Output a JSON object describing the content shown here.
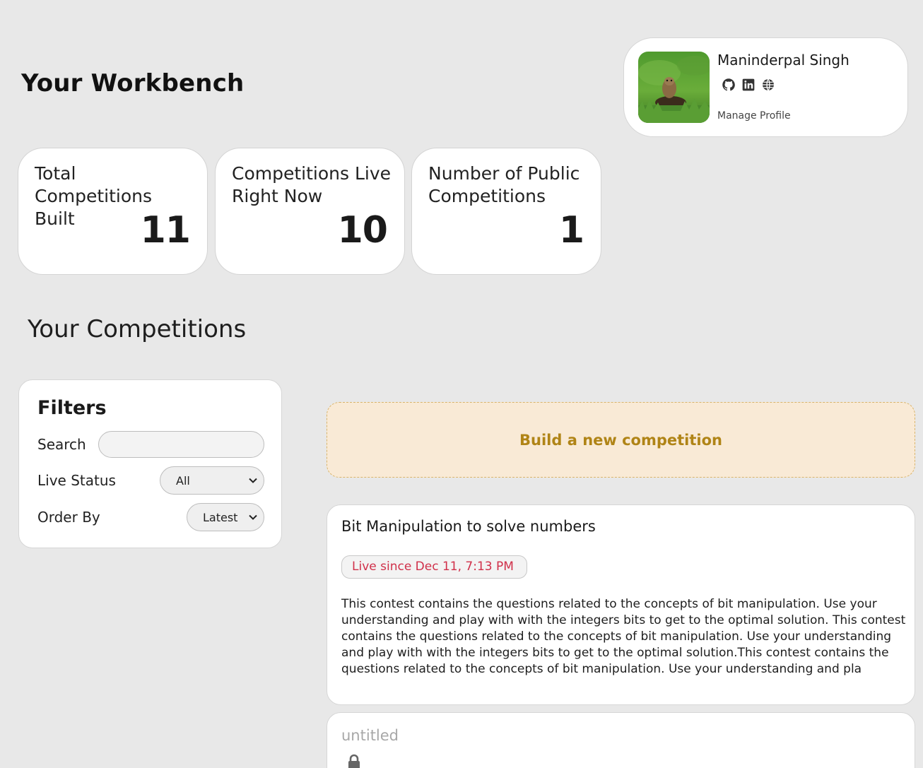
{
  "header": {
    "title": "Your Workbench"
  },
  "profile": {
    "name": "Maninderpal Singh",
    "manage_label": "Manage Profile",
    "icons": [
      "github-icon",
      "linkedin-icon",
      "globe-icon"
    ],
    "avatar": "groundhog-photo"
  },
  "stats": [
    {
      "label": "Total Competitions Built",
      "value": "11"
    },
    {
      "label": "Competitions Live Right Now",
      "value": "10"
    },
    {
      "label": "Number of Public Competitions",
      "value": "1"
    }
  ],
  "competitions_section": {
    "title": "Your Competitions"
  },
  "filters": {
    "title": "Filters",
    "search_label": "Search",
    "search_value": "",
    "live_status_label": "Live Status",
    "live_status_value": "All",
    "order_by_label": "Order By",
    "order_by_value": "Latest"
  },
  "build_new": {
    "label": "Build a new competition"
  },
  "competitions": [
    {
      "title": "Bit Manipulation to solve numbers",
      "status": "Live since Dec 11, 7:13 PM",
      "description": "This contest contains the questions related to the concepts of bit manipulation. Use your understanding and play with with the integers bits to get to the optimal solution. This contest contains the questions related to the concepts of bit manipulation. Use your understanding and play with with the integers bits to get to the optimal solution.This contest contains the questions related to the concepts of bit manipulation. Use your understanding and pla"
    },
    {
      "title": "untitled",
      "icon": "lock-icon"
    }
  ],
  "colors": {
    "background": "#e8e8e8",
    "build_bg": "#f9ead6",
    "build_text": "#b08416",
    "live_text": "#d0304a"
  }
}
